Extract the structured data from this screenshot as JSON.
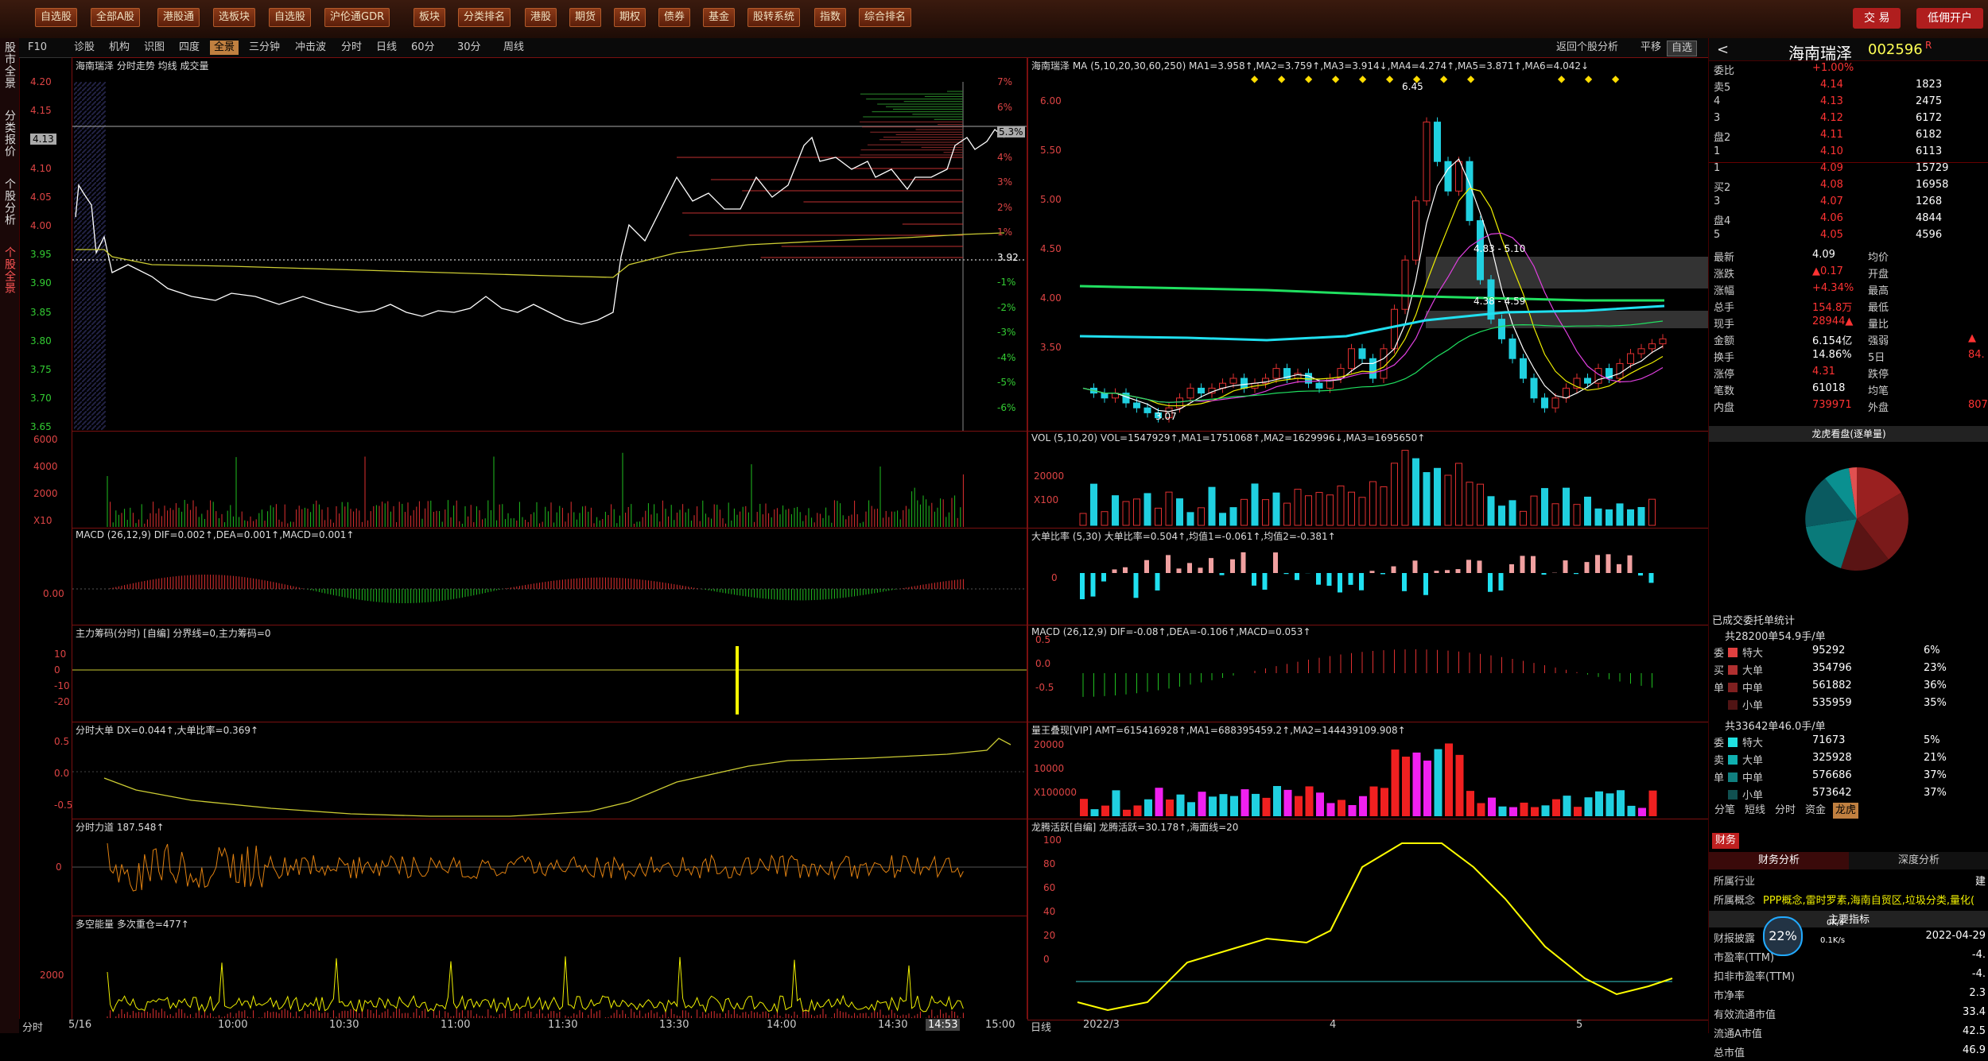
{
  "menu": [
    "自选股",
    "全部A股",
    "港股通",
    "选板块",
    "自选股",
    "沪伦通GDR",
    "板块",
    "分类排名",
    "港股",
    "期货",
    "期权",
    "债券",
    "基金",
    "股转系统",
    "指数",
    "综合排名"
  ],
  "top_right": {
    "trade": "交 易",
    "open_account": "低佣开户"
  },
  "sidebar": [
    "股市全景",
    "分类报价",
    "个股分析",
    "个股全景"
  ],
  "tabs": [
    "F10",
    "诊股",
    "机构",
    "识图",
    "四度",
    "全景",
    "三分钟",
    "冲击波",
    "分时",
    "日线",
    "60分",
    "30分",
    "周线"
  ],
  "tabs_active": "全景",
  "right_tabs": [
    "返回个股分析",
    "平移",
    "自选"
  ],
  "left": {
    "title": "海南瑞泽  分时走势  均线  成交量",
    "price_labels": [
      "4.20",
      "4.15",
      "4.13",
      "4.10",
      "4.05",
      "4.00",
      "3.95",
      "3.90",
      "3.85",
      "3.80",
      "3.75",
      "3.70",
      "3.65"
    ],
    "pct_labels": [
      "7%",
      "6%",
      "5.3%",
      "4%",
      "3%",
      "2%",
      "1%",
      "3.92",
      "-1%",
      "-2%",
      "-3%",
      "-4%",
      "-5%",
      "-6%"
    ],
    "vol_labels": [
      "6000",
      "4000",
      "2000",
      "X10"
    ],
    "macd_title": "MACD  (26,12,9)  DIF=0.002↑,DEA=0.001↑,MACD=0.001↑",
    "macd_label": "0.00",
    "main_title": "主力筹码(分时)  [自编]  分界线=0,主力筹码=0",
    "main_labels": [
      "10",
      "0",
      "-10",
      "-20"
    ],
    "big_title": "分时大单  DX=0.044↑,大单比率=0.369↑",
    "big_labels": [
      "0.5",
      "0.0",
      "-0.5"
    ],
    "force_title": "分时力道  187.548↑",
    "force_label": "0",
    "multi_title": "多空能量  多次重仓=477↑",
    "multi_label": "2000",
    "x_labels": [
      "分时",
      "5/16",
      "10:00",
      "10:30",
      "11:00",
      "11:30",
      "13:30",
      "14:00",
      "14:30",
      "14:53",
      "15:00"
    ]
  },
  "mid": {
    "title": "海南瑞泽  MA  (5,10,20,30,60,250)  MA1=3.958↑,MA2=3.759↑,MA3=3.914↓,MA4=4.274↑,MA5=3.871↑,MA6=4.042↓",
    "price_labels": [
      "6.00",
      "5.50",
      "5.00",
      "4.50",
      "4.00",
      "3.50"
    ],
    "annotations": [
      "4.83 - 5.10",
      "4.38 - 4.59",
      "3.07",
      "6.45"
    ],
    "vol_title": "VOL  (5,10,20)  VOL=1547929↑,MA1=1751068↑,MA2=1629996↓,MA3=1695650↑",
    "vol_labels": [
      "20000",
      "X100"
    ],
    "ratio_title": "大单比率  (5,30)  大单比率=0.504↑,均值1=-0.061↑,均值2=-0.381↑",
    "ratio_label": "0",
    "macd_title": "MACD  (26,12,9)  DIF=-0.08↑,DEA=-0.106↑,MACD=0.053↑",
    "macd_labels": [
      "0.5",
      "0.0",
      "-0.5"
    ],
    "amt_title": "量王叠现[VIP]  AMT=615416928↑,MA1=688395459.2↑,MA2=144439109.908↑",
    "amt_labels": [
      "20000",
      "10000",
      "X100000"
    ],
    "dragon_title": "龙腾活跃[自编]  龙腾活跃=30.178↑,海面线=20",
    "dragon_labels": [
      "100",
      "80",
      "60",
      "40",
      "20",
      "0"
    ],
    "x_labels": [
      "日线",
      "2022/3",
      "4",
      "5"
    ]
  },
  "quote": {
    "name": "海南瑞泽",
    "code": "002596",
    "wb_label": "委比",
    "wb": "+1.00%",
    "sells": [
      [
        "卖5",
        "4.14",
        "1823"
      ],
      [
        "4",
        "4.13",
        "2475"
      ],
      [
        "3",
        "4.12",
        "6172"
      ],
      [
        "盘2",
        "4.11",
        "6182"
      ],
      [
        "1",
        "4.10",
        "6113"
      ]
    ],
    "buys": [
      [
        "1",
        "4.09",
        "15729"
      ],
      [
        "买2",
        "4.08",
        "16958"
      ],
      [
        "3",
        "4.07",
        "1268"
      ],
      [
        "盘4",
        "4.06",
        "4844"
      ],
      [
        "5",
        "4.05",
        "4596"
      ]
    ],
    "stats": [
      [
        "最新",
        "4.09",
        "均价",
        ""
      ],
      [
        "涨跌",
        "▲0.17",
        "开盘",
        ""
      ],
      [
        "涨幅",
        "+4.34%",
        "最高",
        ""
      ],
      [
        "总手",
        "154.8万",
        "最低",
        ""
      ],
      [
        "现手",
        "28944▲",
        "量比",
        ""
      ],
      [
        "金额",
        "6.154亿",
        "强弱",
        "▲"
      ],
      [
        "换手",
        "14.86%",
        "5日",
        "84."
      ],
      [
        "涨停",
        "4.31",
        "跌停",
        ""
      ],
      [
        "笔数",
        "61018",
        "均笔",
        ""
      ],
      [
        "内盘",
        "739971",
        "外盘",
        "807"
      ]
    ],
    "pie_title": "龙虎看盘(逐单量)",
    "orders_title": "已成交委托单统计",
    "buy_total": "共28200单54.9手/单",
    "buy_rows": [
      [
        "委",
        "特大",
        "95292",
        "6%"
      ],
      [
        "买",
        "大单",
        "354796",
        "23%"
      ],
      [
        "单",
        "中单",
        "561882",
        "36%"
      ],
      [
        "",
        "小单",
        "535959",
        "35%"
      ]
    ],
    "sell_total": "共33642单46.0手/单",
    "sell_rows": [
      [
        "委",
        "特大",
        "71673",
        "5%"
      ],
      [
        "卖",
        "大单",
        "325928",
        "21%"
      ],
      [
        "单",
        "中单",
        "576686",
        "37%"
      ],
      [
        "",
        "小单",
        "573642",
        "37%"
      ]
    ],
    "sub_tabs": [
      "分笔",
      "短线",
      "分时",
      "资金",
      "龙虎"
    ],
    "fin_tab": "财务",
    "fin_tabs": [
      "财务分析",
      "深度分析"
    ],
    "industry_label": "所属行业",
    "industry": "建",
    "concept_label": "所属概念",
    "concept": "PPP概念,雷时罗素,海南自贸区,垃圾分类,量化(",
    "key_index": "主要指标",
    "report_label": "财报披露",
    "report_date": "2022-04-29",
    "net_speed": "22%",
    "speeds": [
      "0K/s",
      "0.1K/s"
    ],
    "pe_label": "市盈率(TTM)",
    "pe": "-4.",
    "pe2_label": "扣非市盈率(TTM)",
    "pe2": "-4.",
    "pb_label": "市净率",
    "pb": "2.3",
    "float_label": "有效流通市值",
    "float": "33.4",
    "circ_label": "流通A市值",
    "circ": "42.5",
    "total_label": "总市值",
    "total": "46.9"
  }
}
